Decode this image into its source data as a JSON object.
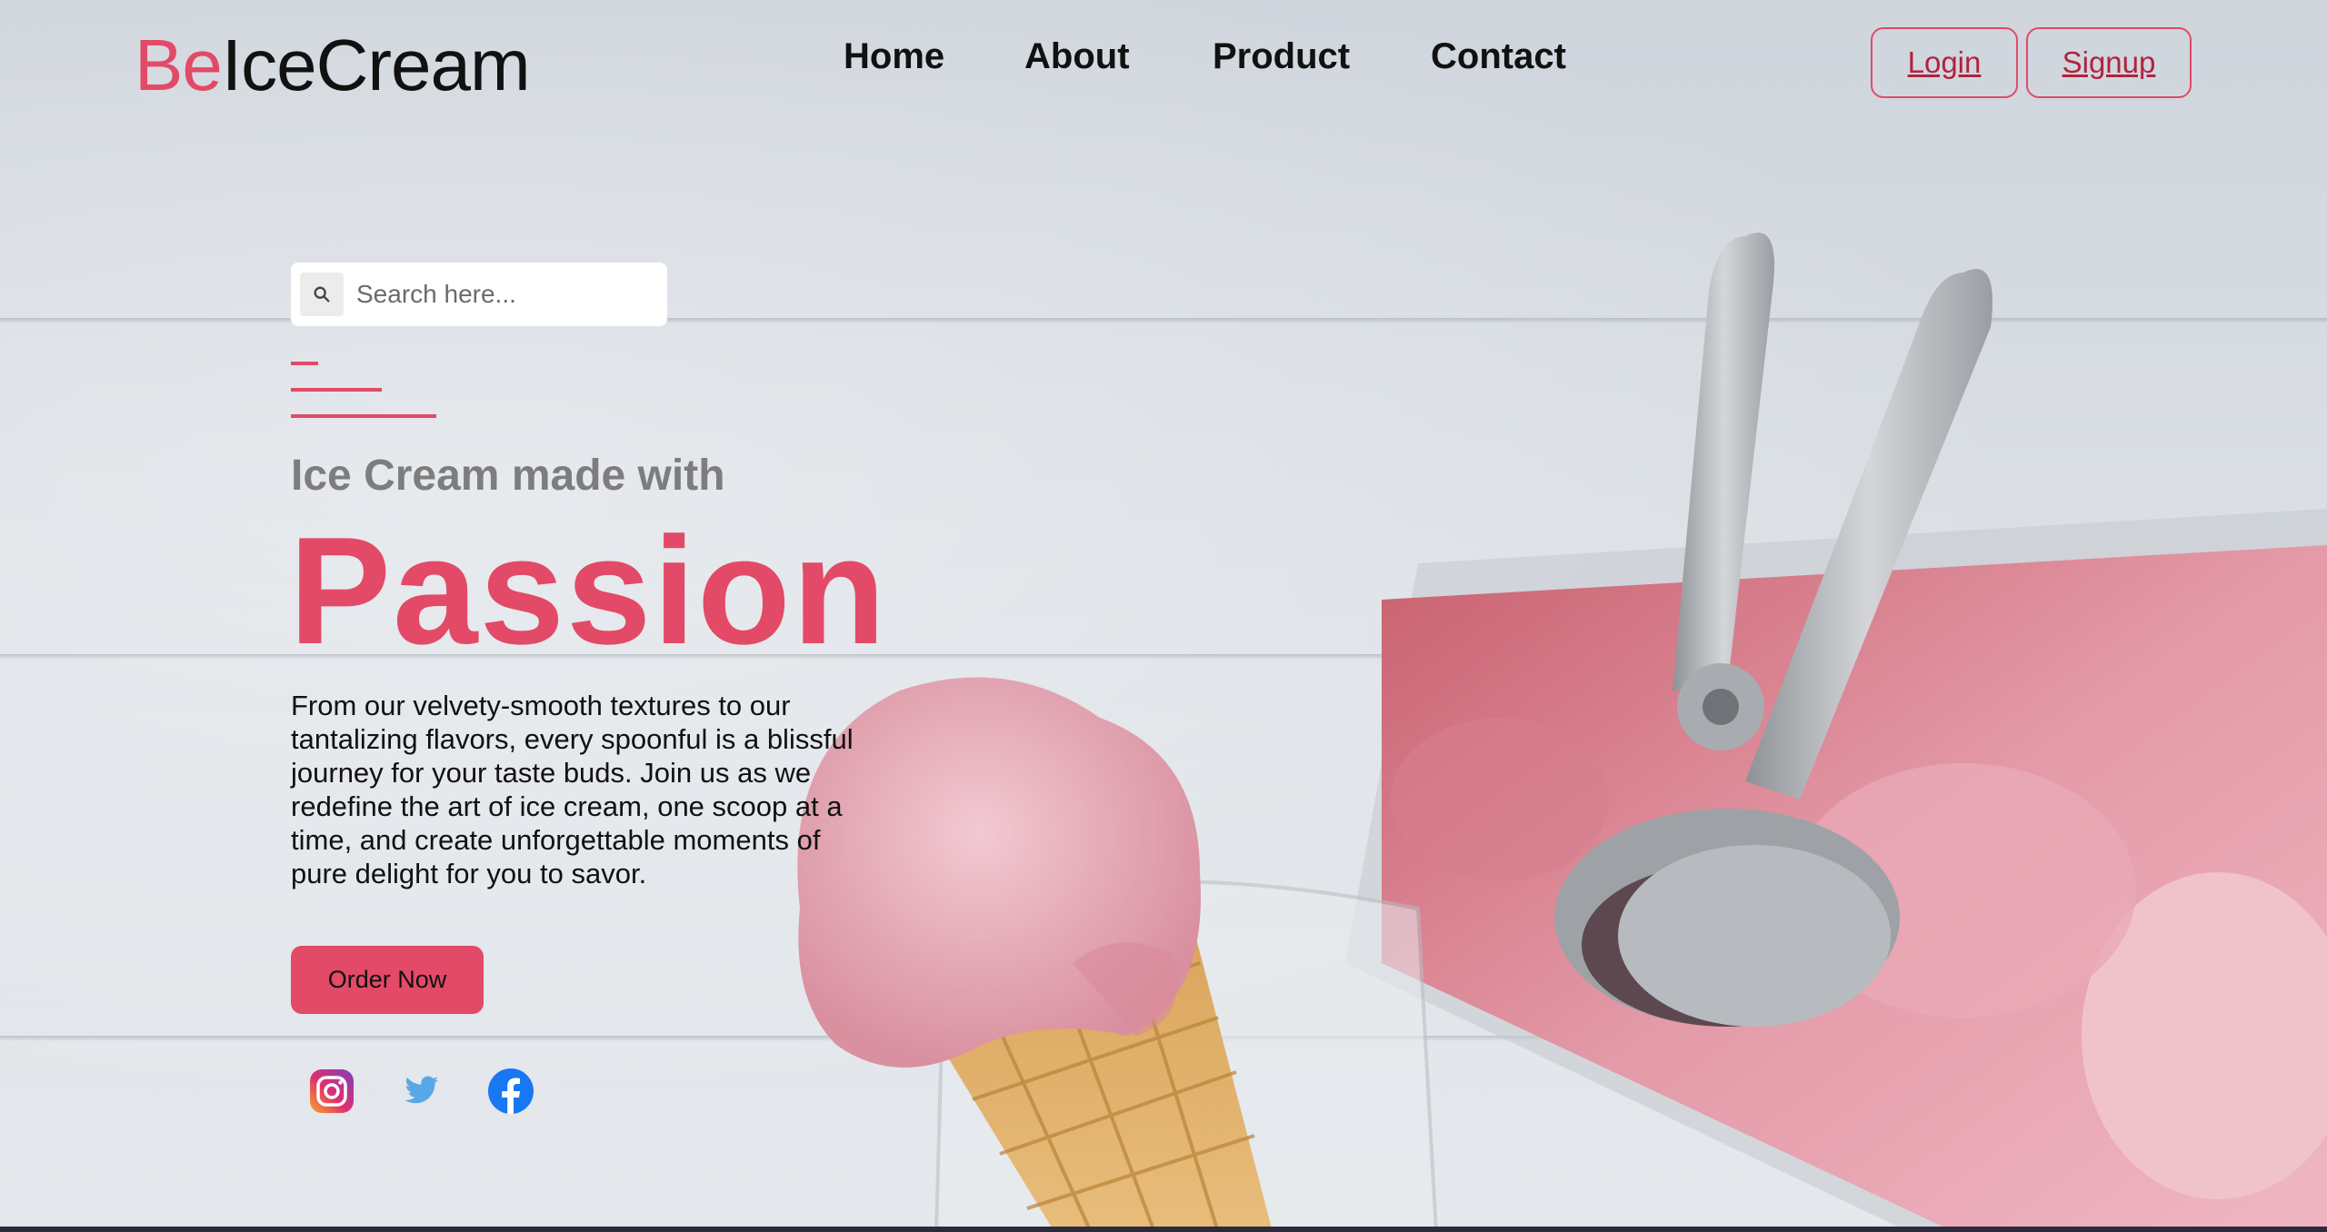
{
  "brand": {
    "prefix": "Be",
    "name": "IceCream"
  },
  "nav": {
    "items": [
      "Home",
      "About",
      "Product",
      "Contact"
    ]
  },
  "auth": {
    "login": "Login",
    "signup": "Signup"
  },
  "search": {
    "placeholder": "Search here..."
  },
  "hero": {
    "subtitle": "Ice Cream made with",
    "headline": "Passion",
    "description": "From our velvety-smooth textures to our tantalizing flavors, every spoonful is a blissful journey for your taste buds. Join us as we redefine the art of ice cream, one scoop at a time, and create unforgettable moments of pure delight for you to savor.",
    "cta": "Order Now"
  },
  "social": [
    "instagram-icon",
    "twitter-icon",
    "facebook-icon"
  ],
  "colors": {
    "accent": "#e24a67",
    "text": "#111111",
    "muted": "#7d7d7d"
  }
}
